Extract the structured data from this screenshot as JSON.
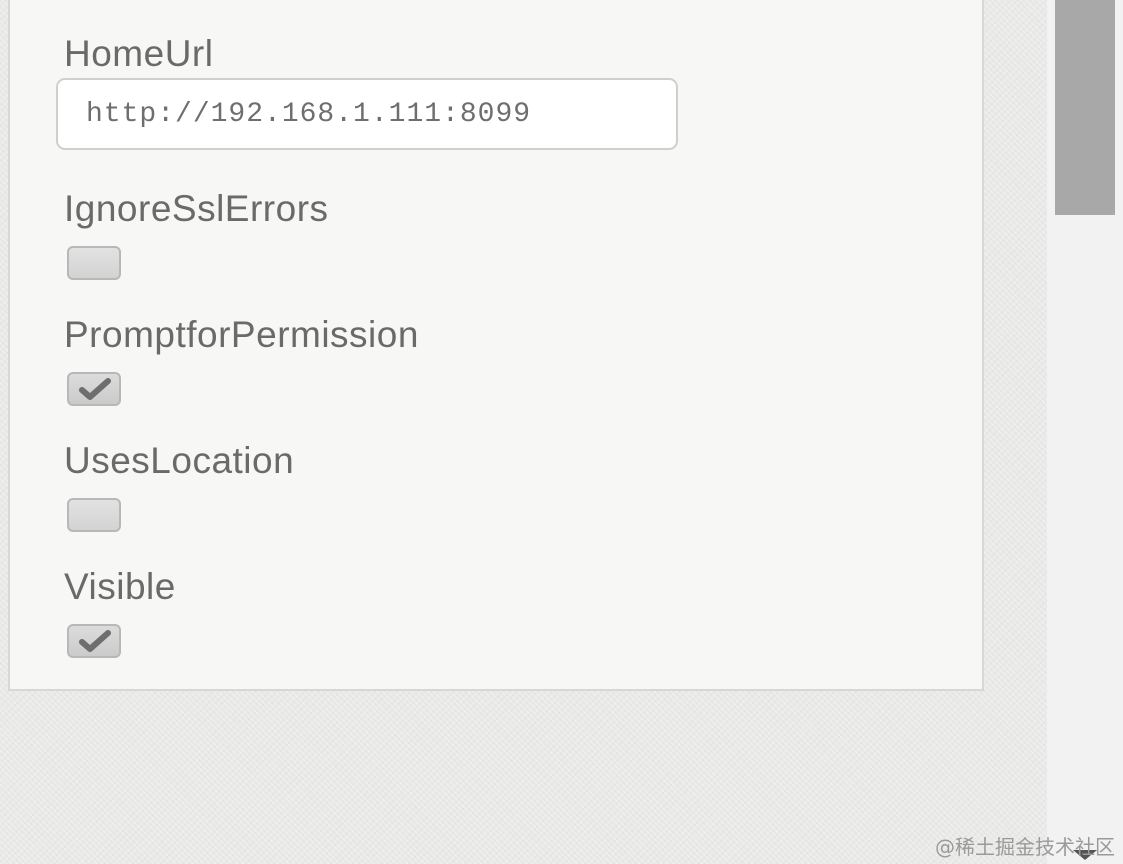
{
  "properties": [
    {
      "label": "HomeUrl",
      "type": "text",
      "value": "http://192.168.1.111:8099"
    },
    {
      "label": "IgnoreSslErrors",
      "type": "checkbox",
      "checked": false
    },
    {
      "label": "PromptforPermission",
      "type": "checkbox",
      "checked": true
    },
    {
      "label": "UsesLocation",
      "type": "checkbox",
      "checked": false
    },
    {
      "label": "Visible",
      "type": "checkbox",
      "checked": true
    }
  ],
  "watermark": "@稀土掘金技术社区",
  "icons": {
    "checkmark": "checkmark-icon",
    "scroll_down": "arrow-down-icon"
  },
  "colors": {
    "panel_background": "#f7f7f5",
    "label_text": "#6a6a6a",
    "scroll_thumb": "#a8a8a8"
  }
}
